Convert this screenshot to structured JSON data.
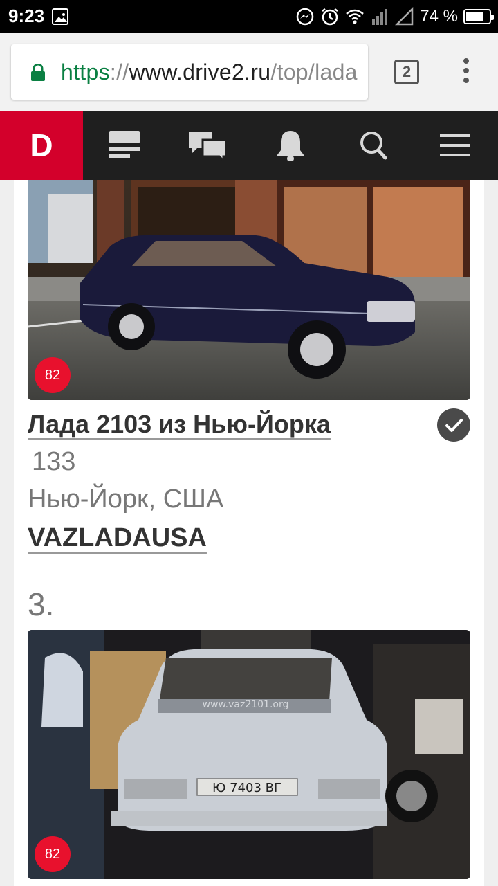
{
  "status_bar": {
    "time": "9:23",
    "battery_percent_text": "74 %",
    "battery_level": 0.74,
    "icons": [
      "gallery-icon",
      "messenger-icon",
      "alarm-icon",
      "wifi-icon",
      "signal-icon"
    ]
  },
  "browser": {
    "url_scheme": "https",
    "url_sep": "://",
    "url_host": "www.drive2.ru",
    "url_path": "/top/lada",
    "tab_count": "2",
    "secure_color": "#0b8043"
  },
  "site_nav": {
    "logo": "D",
    "brand_color": "#d3002b",
    "icons": [
      "feed-icon",
      "chat-icon",
      "bell-icon",
      "search-icon",
      "hamburger-icon"
    ]
  },
  "entry_2": {
    "badge": "82",
    "title": "Лада 2103 из Нью-Йорка",
    "likes": "133",
    "location": "Нью-Йорк, США",
    "author": "VAZLADAUSA",
    "verified": true
  },
  "entry_3": {
    "rank": "3.",
    "badge": "82",
    "plate": "Ю 7403 ВГ",
    "windshield_text": "www.vaz2101.org"
  }
}
